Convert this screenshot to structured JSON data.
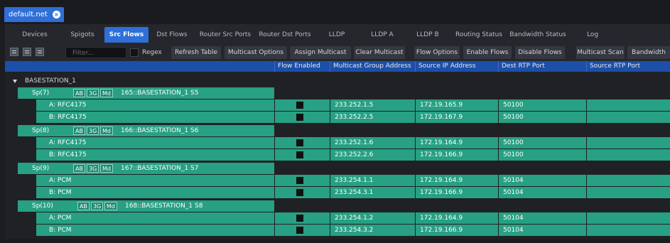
{
  "window": {
    "doc_tab": "default.net",
    "close_icon": "close-circle-icon"
  },
  "tabs": [
    {
      "label": "Devices",
      "active": false
    },
    {
      "label": "Spigots",
      "active": false
    },
    {
      "label": "Src Flows",
      "active": true
    },
    {
      "label": "Dst Flows",
      "active": false
    },
    {
      "label": "Router Src Ports",
      "active": false
    },
    {
      "label": "Router Dst Ports",
      "active": false
    },
    {
      "label": "LLDP",
      "active": false
    },
    {
      "label": "LLDP A",
      "active": false
    },
    {
      "label": "LLDP B",
      "active": false
    },
    {
      "label": "Routing Status",
      "active": false
    },
    {
      "label": "Bandwidth Status",
      "active": false
    },
    {
      "label": "Log",
      "active": false
    }
  ],
  "toolbar": {
    "icons": [
      "expand-all-icon",
      "collapse-icon",
      "collapse-all-icon"
    ],
    "filter_placeholder": "Filter...",
    "regex_label": "Regex",
    "buttons": [
      "Refresh Table",
      "Multicast Options",
      "Assign Multicast",
      "Clear Multicast",
      "Flow Options",
      "Enable Flows",
      "Disable Flows",
      "Multicast Scan",
      "Bandwidth"
    ]
  },
  "columns": [
    "Flow Enabled",
    "Multicast Group Address",
    "Source IP Address",
    "Dest RTP Port",
    "Source RTP Port"
  ],
  "tree": {
    "root": "BASESTATION_1",
    "spigots": [
      {
        "label": "Sp(7)",
        "chips": [
          "AB",
          "3G",
          "Md"
        ],
        "name": "165::BASESTATION_1 S5",
        "flows": [
          {
            "label": "A: RFC4175",
            "multicast": "233.252.1.5",
            "source_ip": "172.19.165.9",
            "dest_port": "50100",
            "source_port": ""
          },
          {
            "label": "B: RFC4175",
            "multicast": "233.252.2.5",
            "source_ip": "172.19.167.9",
            "dest_port": "50100",
            "source_port": ""
          }
        ]
      },
      {
        "label": "Sp(8)",
        "chips": [
          "AB",
          "3G",
          "Md"
        ],
        "name": "166::BASESTATION_1 S6",
        "flows": [
          {
            "label": "A: RFC4175",
            "multicast": "233.252.1.6",
            "source_ip": "172.19.164.9",
            "dest_port": "50100",
            "source_port": ""
          },
          {
            "label": "B: RFC4175",
            "multicast": "233.252.2.6",
            "source_ip": "172.19.166.9",
            "dest_port": "50100",
            "source_port": ""
          }
        ]
      },
      {
        "label": "Sp(9)",
        "chips": [
          "AB",
          "3G",
          "Md"
        ],
        "name": "167::BASESTATION_1 S7",
        "flows": [
          {
            "label": "A: PCM",
            "multicast": "233.254.1.1",
            "source_ip": "172.19.164.9",
            "dest_port": "50104",
            "source_port": ""
          },
          {
            "label": "B: PCM",
            "multicast": "233.254.3.1",
            "source_ip": "172.19.166.9",
            "dest_port": "50104",
            "source_port": ""
          }
        ]
      },
      {
        "label": "Sp(10)",
        "chips": [
          "AB",
          "3G",
          "Md"
        ],
        "name": "168::BASESTATION_1 S8",
        "flows": [
          {
            "label": "A: PCM",
            "multicast": "233.254.1.2",
            "source_ip": "172.19.164.9",
            "dest_port": "50104",
            "source_port": ""
          },
          {
            "label": "B: PCM",
            "multicast": "233.254.3.2",
            "source_ip": "172.19.166.9",
            "dest_port": "50104",
            "source_port": ""
          }
        ]
      }
    ]
  },
  "colors": {
    "accent": "#2e6fd8",
    "row_green": "#27a083",
    "header_blue": "#1c4fa8"
  }
}
